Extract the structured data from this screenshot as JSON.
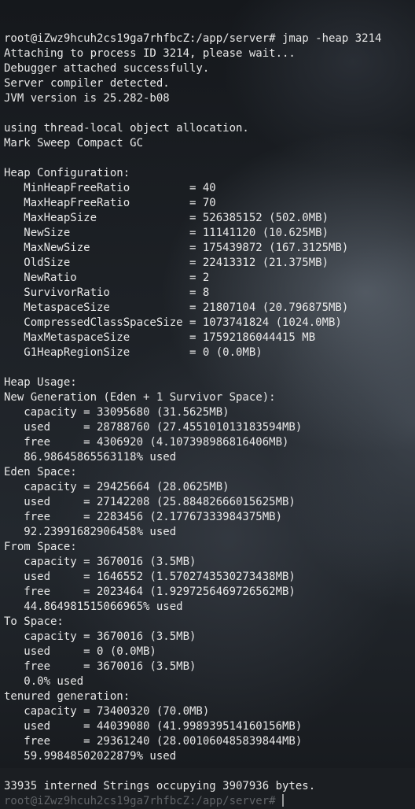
{
  "terminal": {
    "lines": [
      "root@iZwz9hcuh2cs19ga7rhfbcZ:/app/server# jmap -heap 3214",
      "Attaching to process ID 3214, please wait...",
      "Debugger attached successfully.",
      "Server compiler detected.",
      "JVM version is 25.282-b08",
      "",
      "using thread-local object allocation.",
      "Mark Sweep Compact GC",
      "",
      "Heap Configuration:",
      "   MinHeapFreeRatio         = 40",
      "   MaxHeapFreeRatio         = 70",
      "   MaxHeapSize              = 526385152 (502.0MB)",
      "   NewSize                  = 11141120 (10.625MB)",
      "   MaxNewSize               = 175439872 (167.3125MB)",
      "   OldSize                  = 22413312 (21.375MB)",
      "   NewRatio                 = 2",
      "   SurvivorRatio            = 8",
      "   MetaspaceSize            = 21807104 (20.796875MB)",
      "   CompressedClassSpaceSize = 1073741824 (1024.0MB)",
      "   MaxMetaspaceSize         = 17592186044415 MB",
      "   G1HeapRegionSize         = 0 (0.0MB)",
      "",
      "Heap Usage:",
      "New Generation (Eden + 1 Survivor Space):",
      "   capacity = 33095680 (31.5625MB)",
      "   used     = 28788760 (27.455101013183594MB)",
      "   free     = 4306920 (4.107398986816406MB)",
      "   86.98645865563118% used",
      "Eden Space:",
      "   capacity = 29425664 (28.0625MB)",
      "   used     = 27142208 (25.88482666015625MB)",
      "   free     = 2283456 (2.17767333984375MB)",
      "   92.23991682906458% used",
      "From Space:",
      "   capacity = 3670016 (3.5MB)",
      "   used     = 1646552 (1.5702743530273438MB)",
      "   free     = 2023464 (1.9297256469726562MB)",
      "   44.864981515066965% used",
      "To Space:",
      "   capacity = 3670016 (3.5MB)",
      "   used     = 0 (0.0MB)",
      "   free     = 3670016 (3.5MB)",
      "   0.0% used",
      "tenured generation:",
      "   capacity = 73400320 (70.0MB)",
      "   used     = 44039080 (41.998939514160156MB)",
      "   free     = 29361240 (28.001060485839844MB)",
      "   59.99848502022879% used",
      "",
      "33935 interned Strings occupying 3907936 bytes."
    ],
    "partial_prompt_line": "root@iZwz9hcuh2cs19ga7rhfbcZ:/app/server#",
    "colors": {
      "text": "#e8e8e8",
      "background": "#1b1e22"
    }
  }
}
